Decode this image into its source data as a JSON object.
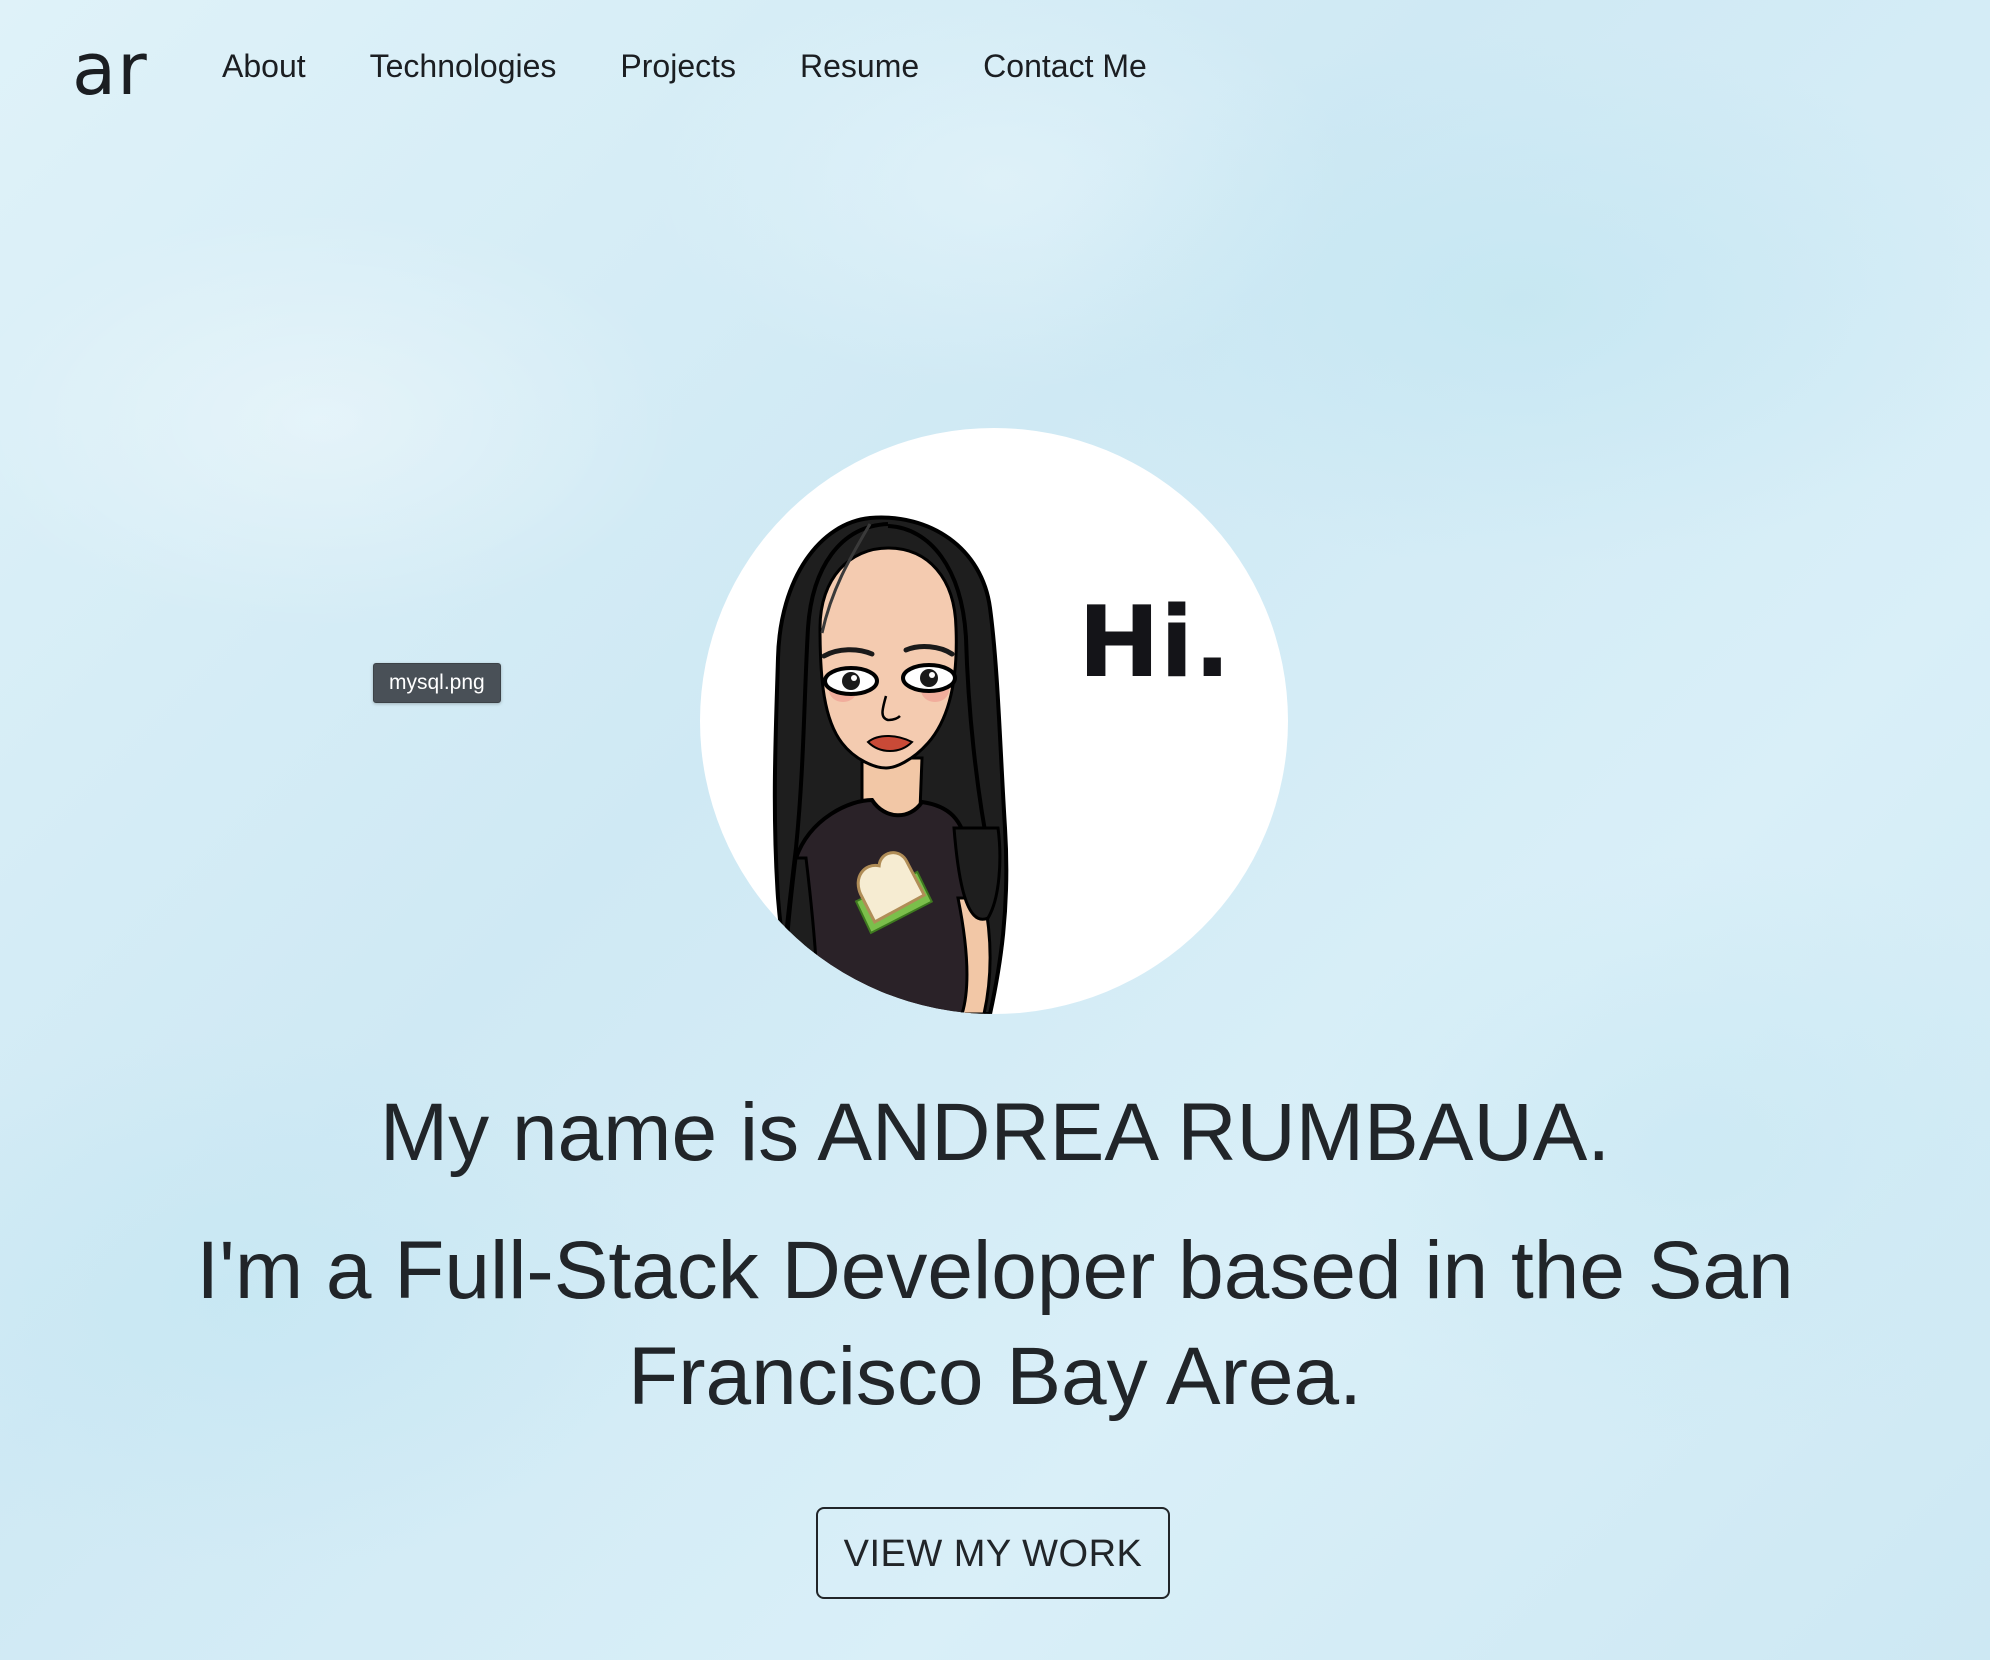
{
  "navbar": {
    "brand": "ar",
    "links": [
      {
        "label": "About"
      },
      {
        "label": "Technologies"
      },
      {
        "label": "Projects"
      },
      {
        "label": "Resume"
      },
      {
        "label": "Contact Me"
      }
    ]
  },
  "hero": {
    "avatar_greeting": "Hi.",
    "tooltip": "mysql.png",
    "name_line": "My name is ANDREA RUMBAUA.",
    "role_line": "I'm a Full-Stack Developer based in the San Francisco Bay Area.",
    "cta_label": "VIEW MY WORK"
  }
}
